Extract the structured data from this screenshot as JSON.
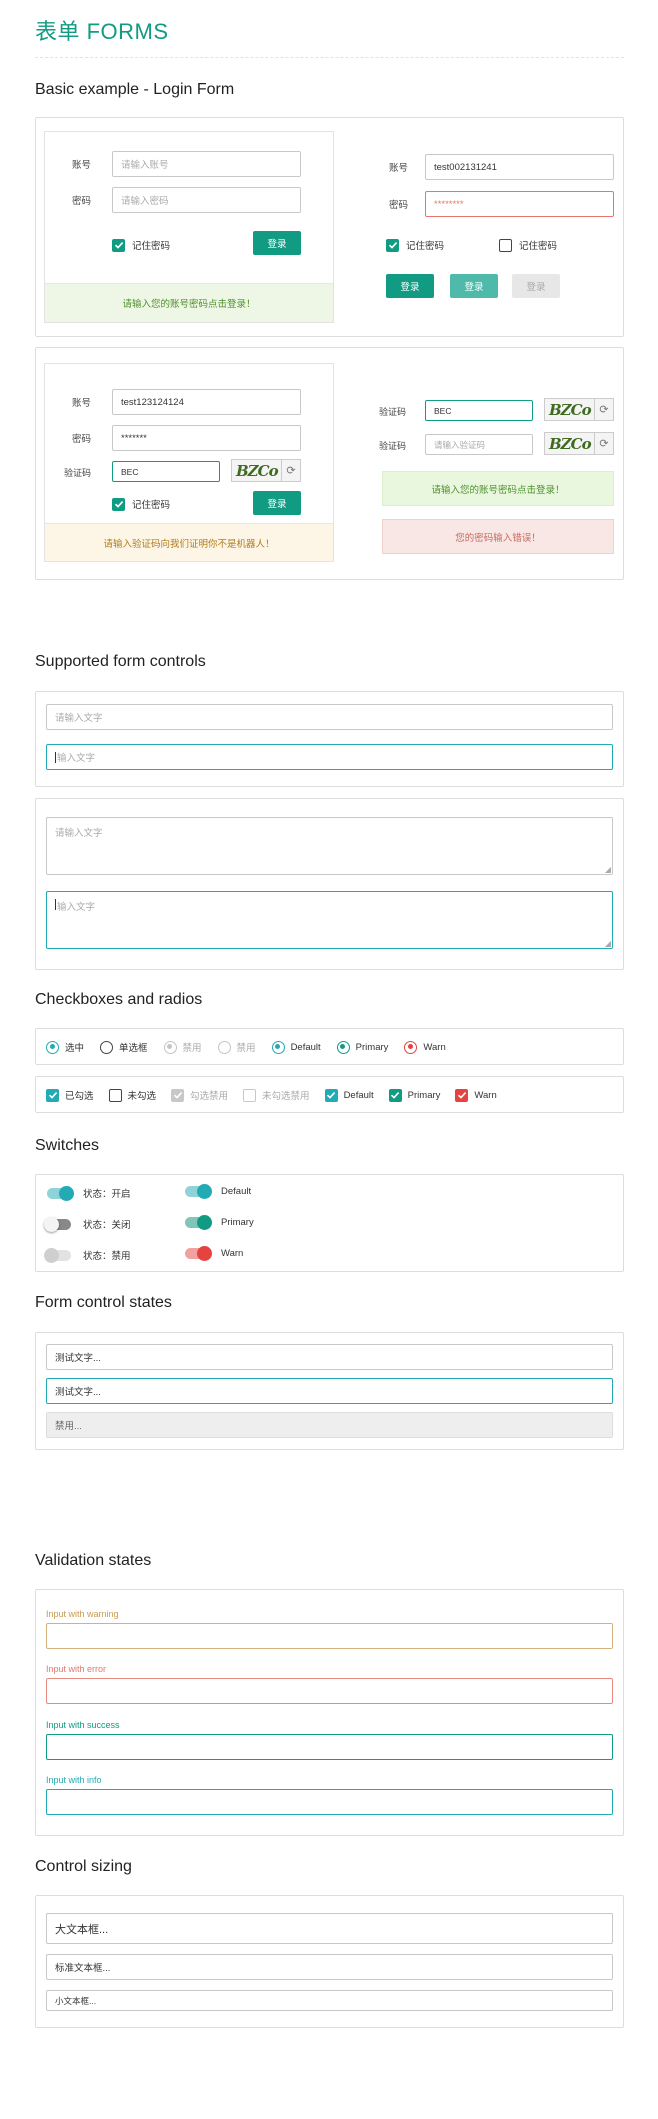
{
  "page": {
    "title": "表单 FORMS"
  },
  "sections": {
    "basic": "Basic example - Login Form",
    "controls": "Supported form controls",
    "checks": "Checkboxes and radios",
    "switches": "Switches",
    "states": "Form control states",
    "validation": "Validation states",
    "sizing": "Control sizing"
  },
  "login1": {
    "account_label": "账号",
    "account_placeholder": "请输入账号",
    "password_label": "密码",
    "password_placeholder": "请输入密码",
    "remember": "记住密码",
    "submit": "登录",
    "notice": "请输入您的账号密码点击登录！"
  },
  "login2": {
    "account_label": "账号",
    "account_value": "test002131241",
    "password_label": "密码",
    "password_value": "********",
    "remember_checked": "记住密码",
    "remember_unchecked": "记住密码",
    "btn_primary": "登录",
    "btn_active": "登录",
    "btn_disabled": "登录"
  },
  "login3": {
    "account_label": "账号",
    "account_value": "test123124124",
    "password_label": "密码",
    "password_value": "*******",
    "captcha_label": "验证码",
    "captcha_value": "BEC",
    "captcha_text": "BZCo",
    "remember": "记住密码",
    "submit": "登录",
    "notice": "请输入验证码向我们证明你不是机器人！"
  },
  "captcha_side": {
    "label1": "验证码",
    "value1": "BEC",
    "captcha1": "BZCo",
    "label2": "验证码",
    "placeholder2": "请输入验证码",
    "captcha2": "BZCo",
    "success": "请输入您的账号密码点击登录！",
    "error": "您的密码输入错误！"
  },
  "controls": {
    "input_placeholder": "请输入文字",
    "input_focus_placeholder": "输入文字",
    "textarea_placeholder": "请输入文字",
    "textarea_focus_placeholder": "输入文字"
  },
  "radios": [
    {
      "label": "选中",
      "state": "checked",
      "color": "#22aab5"
    },
    {
      "label": "单选框",
      "state": "unchecked",
      "color": "#333333"
    },
    {
      "label": "禁用",
      "state": "disabled-checked",
      "color": "#bbbbbb"
    },
    {
      "label": "禁用",
      "state": "disabled",
      "color": "#bbbbbb"
    },
    {
      "label": "Default",
      "state": "checked",
      "color": "#22aab5"
    },
    {
      "label": "Primary",
      "state": "checked",
      "color": "#129b83"
    },
    {
      "label": "Warn",
      "state": "checked",
      "color": "#e64340"
    }
  ],
  "checkboxes": [
    {
      "label": "已勾选",
      "state": "checked",
      "color": "#22aab5"
    },
    {
      "label": "未勾选",
      "state": "unchecked",
      "color": "#333333"
    },
    {
      "label": "勾选禁用",
      "state": "disabled-checked",
      "color": "#c8c8c8"
    },
    {
      "label": "未勾选禁用",
      "state": "disabled",
      "color": "#c8c8c8"
    },
    {
      "label": "Default",
      "state": "checked",
      "color": "#22aab5"
    },
    {
      "label": "Primary",
      "state": "checked",
      "color": "#129b83"
    },
    {
      "label": "Warn",
      "state": "checked",
      "color": "#e64340"
    }
  ],
  "switches": {
    "left": [
      {
        "label": "状态：开启",
        "state": "on",
        "color": "#22aab5"
      },
      {
        "label": "状态：关闭",
        "state": "off",
        "color": "#888888"
      },
      {
        "label": "状态：禁用",
        "state": "disabled",
        "color": "#cccccc"
      }
    ],
    "right": [
      {
        "label": "Default",
        "state": "on",
        "color": "#22aab5"
      },
      {
        "label": "Primary",
        "state": "on",
        "color": "#129b83"
      },
      {
        "label": "Warn",
        "state": "on",
        "color": "#e64340"
      }
    ]
  },
  "states": {
    "normal": "测试文字...",
    "focus": "测试文字...",
    "disabled": "禁用..."
  },
  "validation": {
    "warning_label": "Input with warning",
    "warning_color": "#c99a4a",
    "error_label": "Input with error",
    "error_color": "#e4776c",
    "success_label": "Input with success",
    "success_color": "#129b83",
    "info_label": "Input with info",
    "info_color": "#22aab5"
  },
  "sizing": {
    "large": "大文本框...",
    "normal": "标准文本框...",
    "small": "小文本框..."
  }
}
